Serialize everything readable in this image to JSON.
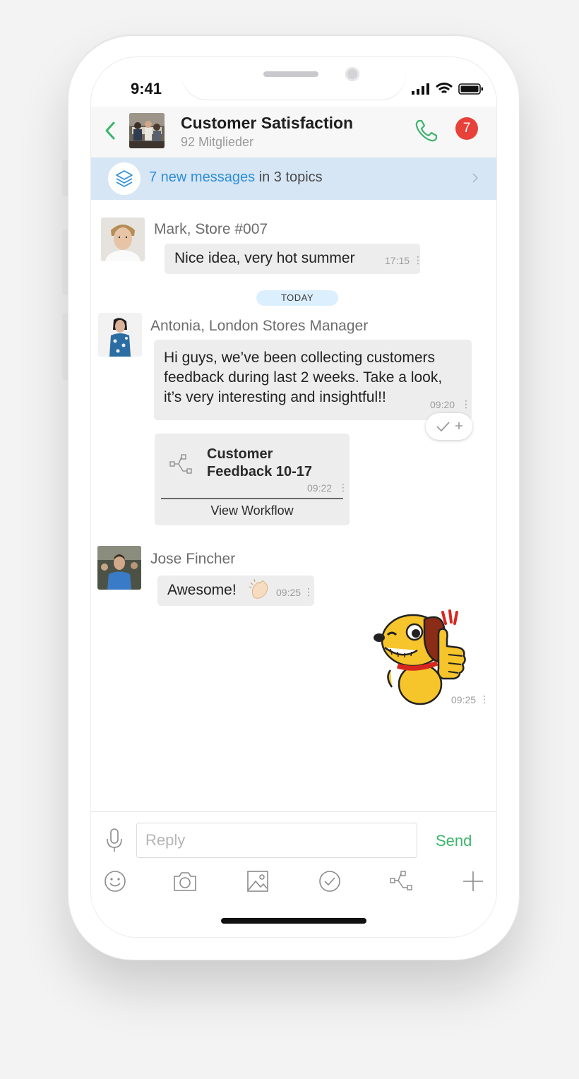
{
  "status": {
    "time": "9:41"
  },
  "header": {
    "title": "Customer Satisfaction",
    "subtitle": "92 Mitglieder",
    "badge_count": "7"
  },
  "banner": {
    "highlight": "7 new messages",
    "rest": " in 3 topics"
  },
  "messages": {
    "mark": {
      "sender": "Mark, Store #007",
      "text": "Nice idea, very hot summer",
      "time": "17:15"
    },
    "day_label": "TODAY",
    "antonia": {
      "sender": "Antonia, London Stores Manager",
      "text_line1": "Hi guys, we’ve been collecting customers",
      "text_line2": "feedback during last 2 weeks. Take a look,",
      "text_line3": "it’s very interesting and insightful!!",
      "time": "09:20"
    },
    "workflow": {
      "title_line1": "Customer",
      "title_line2": "Feedback 10-17",
      "time": "09:22",
      "action": "View Workflow"
    },
    "jose": {
      "sender": "Jose Fincher",
      "text": "Awesome!",
      "time": "09:25"
    },
    "sticker": {
      "time": "09:25"
    }
  },
  "composer": {
    "placeholder": "Reply",
    "send_label": "Send"
  },
  "colors": {
    "accent_green": "#3bb56b",
    "link_blue": "#2f8ed8",
    "badge_red": "#e8413a",
    "banner_bg": "#d6e6f5"
  },
  "icons": [
    "back-icon",
    "phone-icon",
    "layers-icon",
    "chevron-right-icon",
    "microphone-icon",
    "emoji-icon",
    "camera-icon",
    "image-icon",
    "check-icon",
    "workflow-icon",
    "plus-icon"
  ]
}
